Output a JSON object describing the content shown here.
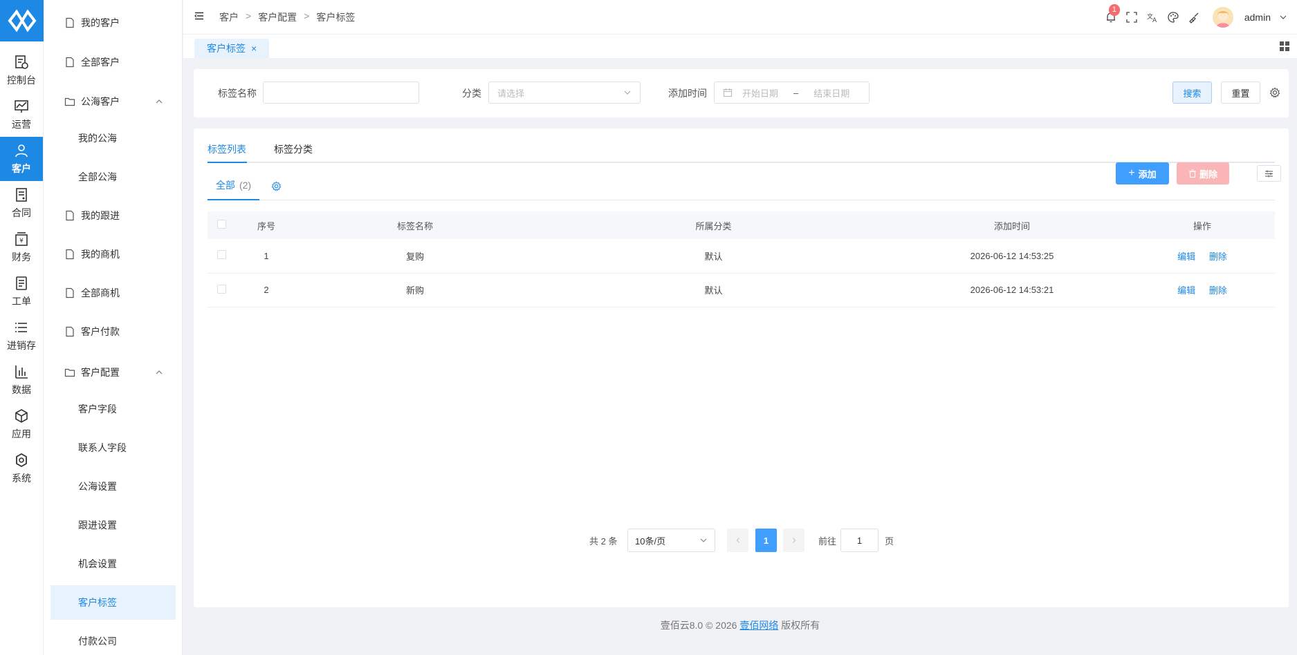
{
  "rail": {
    "items": [
      {
        "label": "控制台",
        "icon": "dashboard-icon"
      },
      {
        "label": "运营",
        "icon": "operations-icon"
      },
      {
        "label": "客户",
        "icon": "customer-icon",
        "active": true
      },
      {
        "label": "合同",
        "icon": "contract-icon"
      },
      {
        "label": "财务",
        "icon": "finance-icon"
      },
      {
        "label": "工单",
        "icon": "ticket-icon"
      },
      {
        "label": "进销存",
        "icon": "inventory-icon"
      },
      {
        "label": "数据",
        "icon": "data-icon"
      },
      {
        "label": "应用",
        "icon": "apps-icon"
      },
      {
        "label": "系统",
        "icon": "system-icon"
      }
    ]
  },
  "submenu": {
    "items": [
      {
        "label": "我的客户",
        "type": "page"
      },
      {
        "label": "全部客户",
        "type": "page"
      },
      {
        "label": "公海客户",
        "type": "folder"
      },
      {
        "label": "我的公海",
        "type": "child"
      },
      {
        "label": "全部公海",
        "type": "child"
      },
      {
        "label": "我的跟进",
        "type": "page"
      },
      {
        "label": "我的商机",
        "type": "page"
      },
      {
        "label": "全部商机",
        "type": "page"
      },
      {
        "label": "客户付款",
        "type": "page"
      },
      {
        "label": "客户配置",
        "type": "folder"
      },
      {
        "label": "客户字段",
        "type": "child"
      },
      {
        "label": "联系人字段",
        "type": "child"
      },
      {
        "label": "公海设置",
        "type": "child"
      },
      {
        "label": "跟进设置",
        "type": "child"
      },
      {
        "label": "机会设置",
        "type": "child"
      },
      {
        "label": "客户标签",
        "type": "child",
        "active": true
      },
      {
        "label": "付款公司",
        "type": "child"
      }
    ]
  },
  "topbar": {
    "breadcrumb": [
      "客户",
      "客户配置",
      "客户标签"
    ],
    "breadcrumb_sep": ">",
    "notification_count": "1",
    "username": "admin"
  },
  "tabs": {
    "active_label": "客户标签",
    "close_glyph": "×"
  },
  "search": {
    "tag_name_label": "标签名称",
    "tag_name_value": "",
    "category_label": "分类",
    "category_placeholder": "请选择",
    "added_time_label": "添加时间",
    "start_placeholder": "开始日期",
    "range_sep": "–",
    "end_placeholder": "结束日期",
    "search_btn": "搜索",
    "reset_btn": "重置"
  },
  "main": {
    "tabs": [
      {
        "label": "标签列表",
        "active": true
      },
      {
        "label": "标签分类",
        "active": false
      }
    ],
    "segment_label": "全部",
    "segment_count": "(2)",
    "add_btn": "添加",
    "delete_btn": "删除"
  },
  "table": {
    "headers": [
      "序号",
      "标签名称",
      "所属分类",
      "添加时间",
      "操作"
    ],
    "rows": [
      {
        "index": "1",
        "name": "复购",
        "category": "默认",
        "time": "2026-06-12 14:53:25",
        "edit": "编辑",
        "delete": "删除"
      },
      {
        "index": "2",
        "name": "新购",
        "category": "默认",
        "time": "2026-06-12 14:53:21",
        "edit": "编辑",
        "delete": "删除"
      }
    ]
  },
  "pager": {
    "total": "共 2 条",
    "page_size": "10条/页",
    "current_page": "1",
    "goto_label": "前往",
    "goto_value": "1",
    "page_unit": "页"
  },
  "footer": {
    "prefix": "壹佰云8.0 © 2026",
    "company": "壹佰网络",
    "suffix": "版权所有"
  },
  "colors": {
    "accent": "#1e88e5",
    "danger_light": "#fab6b6",
    "badge": "#f56c6c"
  }
}
